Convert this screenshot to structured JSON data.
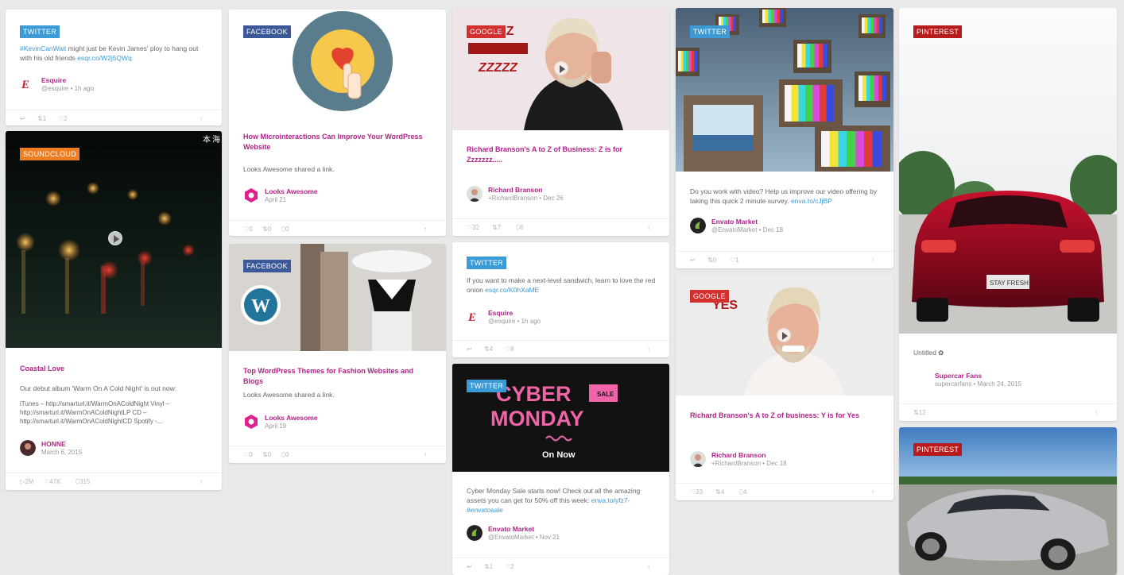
{
  "common": {
    "like": "♡",
    "retweet": "⇅",
    "reply": "↩",
    "comment": "⬯",
    "share": "↑",
    "play": "▷"
  },
  "c1": {
    "badge": "TWITTER",
    "hashtag": "#KevinCanWait",
    "text": " might just be Kevin James' ploy to hang out with his old friends ",
    "link": "esqr.co/W2j5QWq",
    "author": "Esquire",
    "meta": "@esquire • 1h ago",
    "retweets": "1",
    "likes": "2"
  },
  "c2": {
    "badge": "SOUNDCLOUD",
    "title": "Coastal Love",
    "text1": "Our debut album 'Warm On A Cold Night' is out now:",
    "text2": "iTunes – http://smarturl.it/WarmOnAColdNight Vinyl – http://smarturl.it/WarmOnAColdNightLP CD – http://smarturl.it/WarmOnAColdNightCD Spotify -...",
    "author": "HONNE",
    "meta": "March 6, 2015",
    "plays": "2M",
    "likes": "47K",
    "comments": "315"
  },
  "c3": {
    "badge": "FACEBOOK",
    "title": "How Microinteractions Can Improve Your WordPress Website",
    "text": "Looks Awesome shared a link.",
    "author": "Looks Awesome",
    "meta": "April 21",
    "likes": "0",
    "shares": "0",
    "comments": "0"
  },
  "c4": {
    "badge": "FACEBOOK",
    "title": "Top WordPress Themes for Fashion Websites and Blogs",
    "text": "Looks Awesome shared a link.",
    "author": "Looks Awesome",
    "meta": "April 19",
    "likes": "0",
    "shares": "0",
    "comments": "0"
  },
  "c5": {
    "badge": "GOOGLE",
    "img_text1": "A TO Z",
    "img_text2": "ZZZZZ",
    "title": "Richard Branson's A to Z of Business: Z is for Zzzzzzz.....",
    "author": "Richard Branson",
    "meta": "+RichardBranson • Dec 26",
    "likes": "32",
    "shares": "7",
    "comments": "6"
  },
  "c6": {
    "badge": "TWITTER",
    "text": "If you want to make a next-level sandwich, learn to love the red onion ",
    "link": "esqr.co/K0hXaME",
    "author": "Esquire",
    "meta": "@esquire • 1h ago",
    "retweets": "4",
    "likes": "8"
  },
  "c7": {
    "badge": "TWITTER",
    "img_cyber": "CYBER",
    "img_sale": "SALE",
    "img_monday": "MONDAY",
    "img_onnow": "On Now",
    "text": "Cyber Monday Sale starts now! Check out all the amazing assets you can get for 50% off this week: ",
    "link": "enva.to/yfz7-",
    "link2": "#envatosale",
    "author": "Envato Market",
    "meta": "@EnvatoMarket • Nov 21",
    "retweets": "1",
    "likes": "2"
  },
  "c8": {
    "badge": "TWITTER",
    "text": "Do you work with video? Help us improve our video offering by taking this quick 2 minute survey. ",
    "link": "enva.to/cJjBP",
    "author": "Envato Market",
    "meta": "@EnvatoMarket • Dec 18",
    "retweets": "0",
    "likes": "1"
  },
  "c9": {
    "badge": "GOOGLE",
    "img_text": "YES",
    "title": "Richard Branson's A to Z of business: Y is for Yes",
    "author": "Richard Branson",
    "meta": "+RichardBranson • Dec 18",
    "likes": "33",
    "shares": "4",
    "comments": "4"
  },
  "c10": {
    "badge": "PINTEREST",
    "plate": "STAY FRESH",
    "text": "Untitled ✿",
    "author": "Supercar Fans",
    "meta": "supercarfans • March 24, 2015",
    "repins": "12"
  },
  "c11": {
    "badge": "PINTEREST"
  },
  "colors": {
    "accent": "#b2228a",
    "twitter": "#3c9ad4",
    "facebook": "#3b5998",
    "soundcloud": "#f17d21",
    "google": "#d32f2f",
    "pinterest": "#b71b1b"
  }
}
